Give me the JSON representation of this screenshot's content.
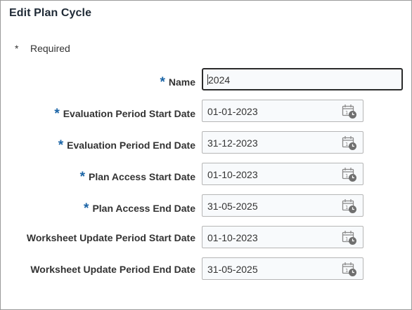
{
  "dialog": {
    "title": "Edit Plan Cycle",
    "required_marker": "*",
    "required_legend": "Required"
  },
  "form": {
    "fields": [
      {
        "label": "Name",
        "required": true,
        "value": "2024",
        "type": "text"
      },
      {
        "label": "Evaluation Period Start Date",
        "required": true,
        "value": "01-01-2023",
        "type": "date",
        "icon": "calendar-icon"
      },
      {
        "label": "Evaluation Period End Date",
        "required": true,
        "value": "31-12-2023",
        "type": "date",
        "icon": "calendar-icon"
      },
      {
        "label": "Plan Access Start Date",
        "required": true,
        "value": "01-10-2023",
        "type": "date",
        "icon": "calendar-icon"
      },
      {
        "label": "Plan Access End Date",
        "required": true,
        "value": "31-05-2025",
        "type": "date",
        "icon": "calendar-icon"
      },
      {
        "label": "Worksheet Update Period Start Date",
        "required": false,
        "value": "01-10-2023",
        "type": "date",
        "icon": "calendar-icon"
      },
      {
        "label": "Worksheet Update Period End Date",
        "required": false,
        "value": "31-05-2025",
        "type": "date",
        "icon": "calendar-icon"
      }
    ]
  },
  "colors": {
    "required_star": "#1a64a6",
    "title": "#1f2a36",
    "text": "#333333",
    "field_border": "#b6b6b6",
    "focused_border": "#2b2b2b"
  }
}
